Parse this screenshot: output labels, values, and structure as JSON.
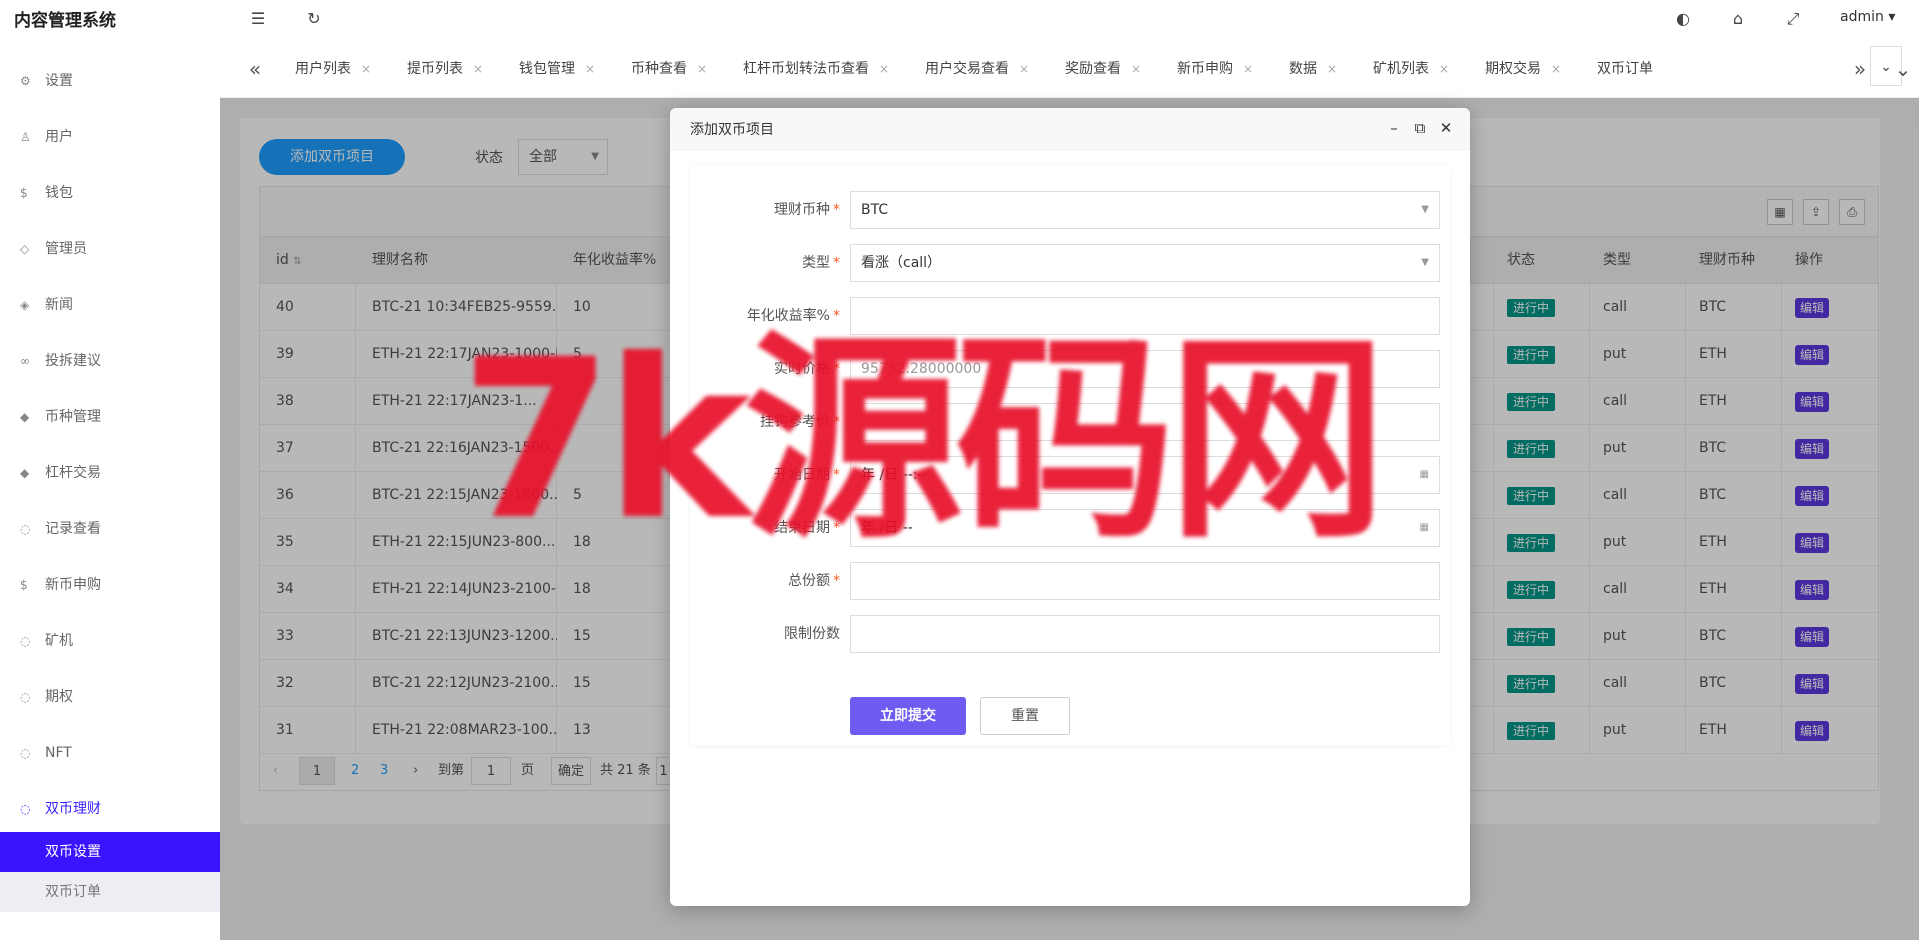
{
  "header": {
    "app_title": "内容管理系统",
    "user": "admin ▾",
    "icons": [
      "menu-fold-icon",
      "refresh-icon",
      "theme-icon",
      "tag-icon",
      "fullscreen-icon"
    ]
  },
  "sidebar": {
    "items": [
      {
        "label": "设置",
        "icon": "gear-icon"
      },
      {
        "label": "用户",
        "icon": "user-icon"
      },
      {
        "label": "钱包",
        "icon": "dollar-icon"
      },
      {
        "label": "管理员",
        "icon": "shield-icon"
      },
      {
        "label": "新闻",
        "icon": "tag-icon"
      },
      {
        "label": "投拆建议",
        "icon": "link-icon"
      },
      {
        "label": "币种管理",
        "icon": "diamond-icon"
      },
      {
        "label": "杠杆交易",
        "icon": "diamond-icon"
      },
      {
        "label": "记录查看",
        "icon": "circle-icon"
      },
      {
        "label": "新币申购",
        "icon": "dollar-icon"
      },
      {
        "label": "矿机",
        "icon": "circle-icon"
      },
      {
        "label": "期权",
        "icon": "circle-icon"
      },
      {
        "label": "NFT",
        "icon": "circle-icon"
      },
      {
        "label": "双币理财",
        "icon": "circle-icon"
      }
    ],
    "subitems": [
      {
        "label": "双币设置"
      },
      {
        "label": "双币订单"
      }
    ]
  },
  "tabs": {
    "items": [
      "用户列表",
      "提币列表",
      "钱包管理",
      "币种查看",
      "杠杆币划转法币查看",
      "用户交易查看",
      "奖励查看",
      "新币申购",
      "数据",
      "矿机列表",
      "期权交易",
      "双币订单"
    ],
    "close": "×"
  },
  "toolbar": {
    "add_label": "添加双币项目",
    "status_label": "状态",
    "status_value": "全部"
  },
  "table": {
    "headers": {
      "id": "id",
      "name": "理财名称",
      "rate": "年化收益率%",
      "status": "状态",
      "type": "类型",
      "coin": "理财币种",
      "op": "操作"
    },
    "rows": [
      {
        "id": "40",
        "name": "BTC-21 10:34FEB25-9559...",
        "rate": "10",
        "status": "进行中",
        "type": "call",
        "coin": "BTC",
        "op": "编辑"
      },
      {
        "id": "39",
        "name": "ETH-21 22:17JAN23-1000-P",
        "rate": "5",
        "status": "进行中",
        "type": "put",
        "coin": "ETH",
        "op": "编辑"
      },
      {
        "id": "38",
        "name": "ETH-21 22:17JAN23-1...",
        "rate": "",
        "status": "进行中",
        "type": "call",
        "coin": "ETH",
        "op": "编辑"
      },
      {
        "id": "37",
        "name": "BTC-21 22:16JAN23-1500...",
        "rate": "",
        "status": "进行中",
        "type": "put",
        "coin": "BTC",
        "op": "编辑"
      },
      {
        "id": "36",
        "name": "BTC-21 22:15JAN23-1800...",
        "rate": "5",
        "status": "进行中",
        "type": "call",
        "coin": "BTC",
        "op": "编辑"
      },
      {
        "id": "35",
        "name": "ETH-21 22:15JUN23-800...",
        "rate": "18",
        "status": "进行中",
        "type": "put",
        "coin": "ETH",
        "op": "编辑"
      },
      {
        "id": "34",
        "name": "ETH-21 22:14JUN23-2100-C",
        "rate": "18",
        "status": "进行中",
        "type": "call",
        "coin": "ETH",
        "op": "编辑"
      },
      {
        "id": "33",
        "name": "BTC-21 22:13JUN23-1200...",
        "rate": "15",
        "status": "进行中",
        "type": "put",
        "coin": "BTC",
        "op": "编辑"
      },
      {
        "id": "32",
        "name": "BTC-21 22:12JUN23-2100...",
        "rate": "15",
        "status": "进行中",
        "type": "call",
        "coin": "BTC",
        "op": "编辑"
      },
      {
        "id": "31",
        "name": "ETH-21 22:08MAR23-100...",
        "rate": "13",
        "status": "进行中",
        "type": "put",
        "coin": "ETH",
        "op": "编辑"
      }
    ]
  },
  "pager": {
    "prev": "‹",
    "pages": [
      "1",
      "2",
      "3"
    ],
    "next": "›",
    "goto_label": "到第",
    "goto_value": "1",
    "page_unit": "页",
    "confirm": "确定",
    "total": "共 21 条",
    "size": "1"
  },
  "modal": {
    "title": "添加双币项目",
    "fields": [
      {
        "label": "理财币种",
        "required": true,
        "value": "BTC",
        "type": "select"
      },
      {
        "label": "类型",
        "required": true,
        "value": "看涨（call）",
        "type": "select"
      },
      {
        "label": "年化收益率%",
        "required": true,
        "value": "",
        "type": "text"
      },
      {
        "label": "实时价格",
        "required": true,
        "value": "95752.28000000",
        "type": "text"
      },
      {
        "label": "挂钩参考价",
        "required": true,
        "value": "",
        "type": "text"
      },
      {
        "label": "开始日期",
        "required": true,
        "value": "年 /日 --:--",
        "type": "datetime"
      },
      {
        "label": "结束日期",
        "required": true,
        "value": "年 /日 --",
        "type": "datetime"
      },
      {
        "label": "总份额",
        "required": true,
        "value": "",
        "type": "text"
      },
      {
        "label": "限制份数",
        "required": false,
        "value": "",
        "type": "text"
      }
    ],
    "submit": "立即提交",
    "reset": "重置"
  },
  "watermark": "7k源码网",
  "colors": {
    "accent": "#3b13ff",
    "primary_btn": "#1e9fff",
    "badge": "#009688",
    "edit": "#5d3ae0",
    "watermark": "#e8102a"
  }
}
